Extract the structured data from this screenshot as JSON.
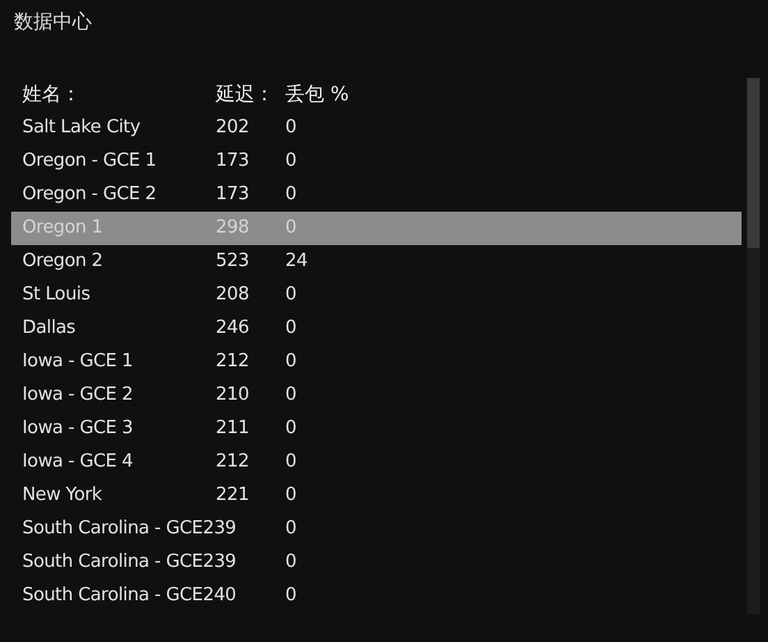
{
  "title": "数据中心",
  "table": {
    "columns": [
      "姓名：",
      "延迟：",
      "丢包 %"
    ],
    "rows": [
      {
        "name": "Salt Lake City",
        "latency": "202",
        "loss": "0",
        "selected": false
      },
      {
        "name": "Oregon - GCE 1",
        "latency": "173",
        "loss": "0",
        "selected": false
      },
      {
        "name": "Oregon - GCE 2",
        "latency": "173",
        "loss": "0",
        "selected": false
      },
      {
        "name": "Oregon 1",
        "latency": "298",
        "loss": "0",
        "selected": true
      },
      {
        "name": "Oregon 2",
        "latency": "523",
        "loss": "24",
        "selected": false
      },
      {
        "name": "St Louis",
        "latency": "208",
        "loss": "0",
        "selected": false
      },
      {
        "name": "Dallas",
        "latency": "246",
        "loss": "0",
        "selected": false
      },
      {
        "name": "Iowa - GCE 1",
        "latency": "212",
        "loss": "0",
        "selected": false
      },
      {
        "name": "Iowa - GCE 2",
        "latency": "210",
        "loss": "0",
        "selected": false
      },
      {
        "name": "Iowa - GCE 3",
        "latency": "211",
        "loss": "0",
        "selected": false
      },
      {
        "name": "Iowa - GCE 4",
        "latency": "212",
        "loss": "0",
        "selected": false
      },
      {
        "name": "New York",
        "latency": "221",
        "loss": "0",
        "selected": false
      },
      {
        "name": "South Carolina - GCE239",
        "latency": "",
        "loss": "0",
        "selected": false
      },
      {
        "name": "South Carolina - GCE239",
        "latency": "",
        "loss": "0",
        "selected": false
      },
      {
        "name": "South Carolina - GCE240",
        "latency": "",
        "loss": "0",
        "selected": false
      }
    ]
  }
}
